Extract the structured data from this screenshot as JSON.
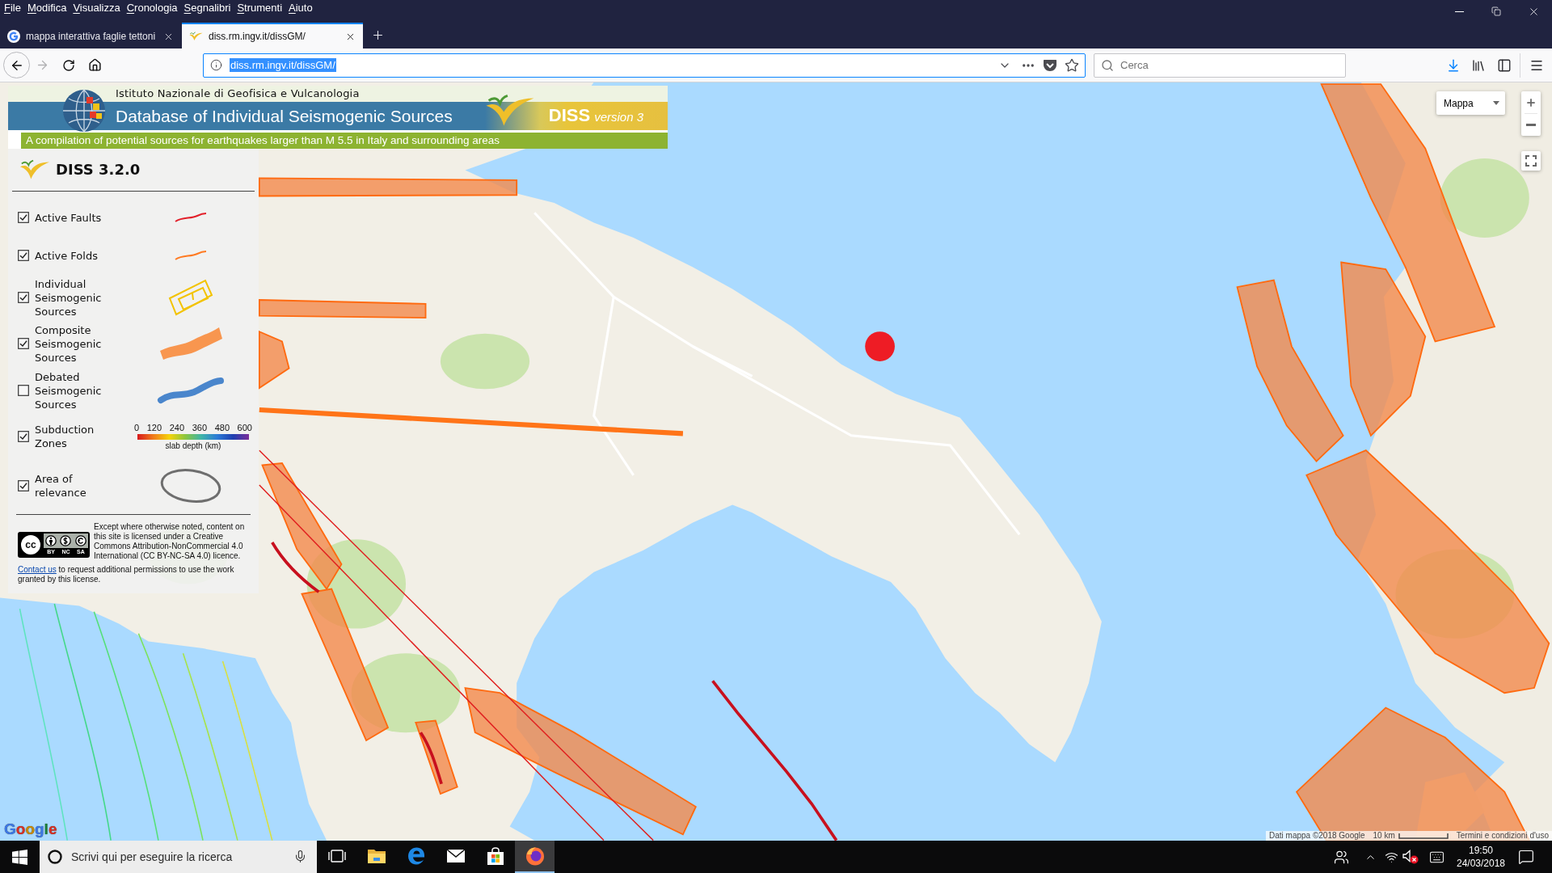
{
  "browser": {
    "menu": [
      "File",
      "Modifica",
      "Visualizza",
      "Cronologia",
      "Segnalibri",
      "Strumenti",
      "Aiuto"
    ],
    "tabs": [
      {
        "title": "mappa interattiva faglie tettoni",
        "selected": false
      },
      {
        "title": "diss.rm.ingv.it/dissGM/",
        "selected": true
      }
    ],
    "address": {
      "value": "diss.rm.ingv.it/dissGM/",
      "highlighted": true
    },
    "search": {
      "placeholder": "Cerca"
    }
  },
  "banner": {
    "institute": "Istituto Nazionale di Geofisica e Vulcanologia",
    "title": "Database of Individual Seismogenic Sources",
    "badge_name": "DISS",
    "badge_version": "version 3",
    "subtitle": "A compilation of potential sources for earthquakes larger than M 5.5 in Italy and surrounding areas"
  },
  "legend": {
    "title": "DISS 3.2.0",
    "items": [
      {
        "kind": "fault",
        "label": "Active Faults",
        "checked": true
      },
      {
        "kind": "fold",
        "label": "Active Folds",
        "checked": true
      },
      {
        "kind": "individual",
        "label": "Individual Seismogenic Sources",
        "checked": true
      },
      {
        "kind": "composite",
        "label": "Composite Seismogenic Sources",
        "checked": true
      },
      {
        "kind": "debated",
        "label": "Debated Seismogenic Sources",
        "checked": false
      },
      {
        "kind": "subduction",
        "label": "Subduction Zones",
        "checked": true,
        "scale": {
          "ticks": [
            "0",
            "120",
            "240",
            "360",
            "480",
            "600"
          ],
          "caption": "slab depth (km)"
        }
      },
      {
        "kind": "area",
        "label": "Area of relevance",
        "checked": true
      }
    ]
  },
  "license": {
    "badge": {
      "mark": "cc",
      "labels": [
        "BY",
        "NC",
        "SA"
      ]
    },
    "text": "Except where otherwise noted, content on this site is licensed under a Creative Commons Attribution-NonCommercial 4.0 International (CC BY-NC-SA 4.0) licence.",
    "link": "Contact us",
    "note": "to request additional permissions to use the work granted by this license."
  },
  "map": {
    "type_control": "Mappa",
    "logo": "Google",
    "attribution": "Dati mappa ©2018 Google",
    "scale": "10 km",
    "terms": "Termini e condizioni d'uso"
  },
  "taskbar": {
    "search": {
      "placeholder": "Scrivi qui per eseguire la ricerca"
    },
    "apps": [
      {
        "kind": "task-view",
        "selected": false
      },
      {
        "kind": "explorer",
        "selected": false
      },
      {
        "kind": "edge",
        "selected": false
      },
      {
        "kind": "mail",
        "selected": false
      },
      {
        "kind": "store",
        "selected": false
      },
      {
        "kind": "firefox",
        "selected": true
      }
    ],
    "clock": {
      "time": "19:50",
      "date": "24/03/2018"
    }
  }
}
